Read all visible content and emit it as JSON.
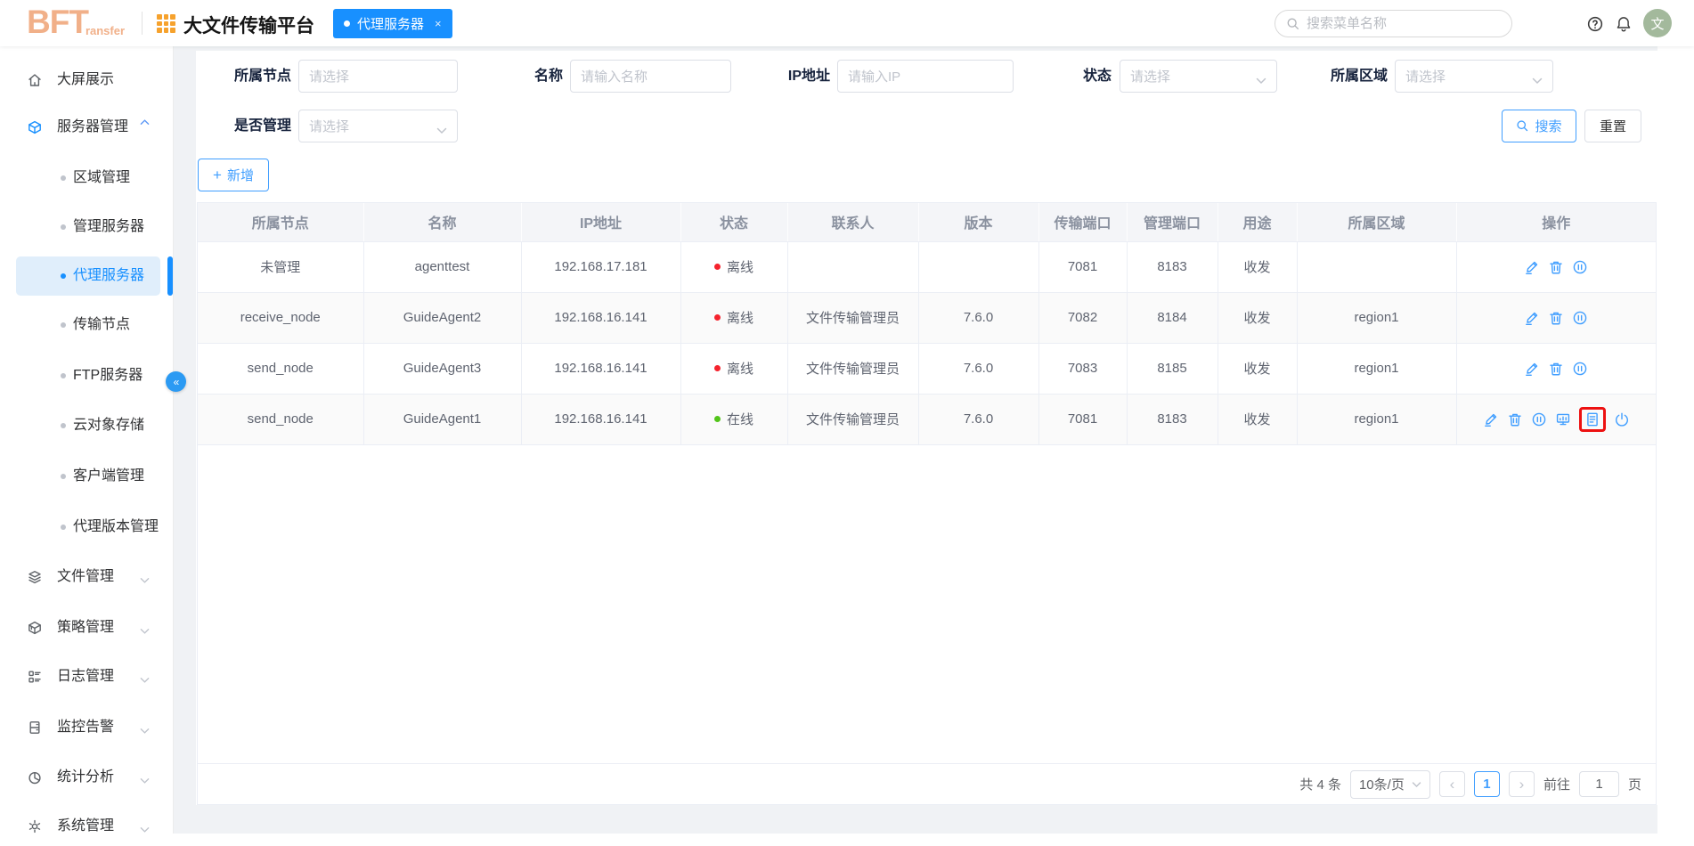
{
  "header": {
    "logo_bold": "BFT",
    "logo_rest": "ransfer",
    "app_title": "大文件传输平台",
    "tab": {
      "label": "代理服务器",
      "close": "×"
    },
    "search_placeholder": "搜索菜单名称",
    "avatar_text": "文"
  },
  "sidebar": {
    "items": [
      {
        "label": "大屏展示",
        "icon": "home-icon",
        "type": "top"
      },
      {
        "label": "服务器管理",
        "icon": "cube-icon",
        "type": "group",
        "expanded": true,
        "highlight": true
      },
      {
        "label": "区域管理",
        "type": "sub"
      },
      {
        "label": "管理服务器",
        "type": "sub"
      },
      {
        "label": "代理服务器",
        "type": "sub",
        "active": true
      },
      {
        "label": "传输节点",
        "type": "sub"
      },
      {
        "label": "FTP服务器",
        "type": "sub"
      },
      {
        "label": "云对象存储",
        "type": "sub"
      },
      {
        "label": "客户端管理",
        "type": "sub"
      },
      {
        "label": "代理版本管理",
        "type": "sub"
      },
      {
        "label": "文件管理",
        "icon": "layers-icon",
        "type": "group"
      },
      {
        "label": "策略管理",
        "icon": "box-icon",
        "type": "group"
      },
      {
        "label": "日志管理",
        "icon": "list-icon",
        "type": "group"
      },
      {
        "label": "监控告警",
        "icon": "monitor-icon",
        "type": "group"
      },
      {
        "label": "统计分析",
        "icon": "pie-icon",
        "type": "group"
      },
      {
        "label": "系统管理",
        "icon": "gear-icon",
        "type": "group"
      }
    ]
  },
  "filters": {
    "fields": [
      {
        "label": "所属节点",
        "placeholder": "请选择",
        "control": "select",
        "chevron": false
      },
      {
        "label": "名称",
        "placeholder": "请输入名称",
        "control": "input",
        "chevron": false
      },
      {
        "label": "IP地址",
        "placeholder": "请输入IP",
        "control": "input",
        "chevron": false
      },
      {
        "label": "状态",
        "placeholder": "请选择",
        "control": "select",
        "chevron": true
      },
      {
        "label": "所属区域",
        "placeholder": "请选择",
        "control": "select",
        "chevron": true
      },
      {
        "label": "是否管理",
        "placeholder": "请选择",
        "control": "select",
        "chevron": true
      }
    ],
    "search_label": "搜索",
    "reset_label": "重置"
  },
  "toolbar": {
    "add_label": "新增"
  },
  "table": {
    "columns": [
      "所属节点",
      "名称",
      "IP地址",
      "状态",
      "联系人",
      "版本",
      "传输端口",
      "管理端口",
      "用途",
      "所属区域",
      "操作"
    ],
    "status_colors": {
      "offline": "#f5222d",
      "online": "#52c41a"
    },
    "rows": [
      {
        "node": "未管理",
        "name": "agenttest",
        "ip": "192.168.17.181",
        "status": {
          "label": "离线",
          "type": "offline"
        },
        "contact": "",
        "version": "",
        "transfer_port": "7081",
        "manage_port": "8183",
        "usage": "收发",
        "region": "",
        "actions": [
          "edit",
          "delete",
          "pause"
        ],
        "highlighted_action": ""
      },
      {
        "node": "receive_node",
        "name": "GuideAgent2",
        "ip": "192.168.16.141",
        "status": {
          "label": "离线",
          "type": "offline"
        },
        "contact": "文件传输管理员",
        "version": "7.6.0",
        "transfer_port": "7082",
        "manage_port": "8184",
        "usage": "收发",
        "region": "region1",
        "actions": [
          "edit",
          "delete",
          "pause"
        ],
        "highlighted_action": ""
      },
      {
        "node": "send_node",
        "name": "GuideAgent3",
        "ip": "192.168.16.141",
        "status": {
          "label": "离线",
          "type": "offline"
        },
        "contact": "文件传输管理员",
        "version": "7.6.0",
        "transfer_port": "7083",
        "manage_port": "8185",
        "usage": "收发",
        "region": "region1",
        "actions": [
          "edit",
          "delete",
          "pause"
        ],
        "highlighted_action": ""
      },
      {
        "node": "send_node",
        "name": "GuideAgent1",
        "ip": "192.168.16.141",
        "status": {
          "label": "在线",
          "type": "online"
        },
        "contact": "文件传输管理员",
        "version": "7.6.0",
        "transfer_port": "7081",
        "manage_port": "8183",
        "usage": "收发",
        "region": "region1",
        "actions": [
          "edit",
          "delete",
          "pause",
          "monitor",
          "document",
          "power"
        ],
        "highlighted_action": "document"
      }
    ]
  },
  "pagination": {
    "total": "共 4 条",
    "page_size": "10条/页",
    "prev": "‹",
    "current": "1",
    "next": "›",
    "goto_label": "前往",
    "goto_value": "1",
    "page_unit": "页"
  },
  "colors": {
    "primary": "#1890ff",
    "action_icon": "#409eff",
    "highlight_box": "#ed1111",
    "logo": "#f1b089",
    "grid_icon": "#f6a22d"
  }
}
